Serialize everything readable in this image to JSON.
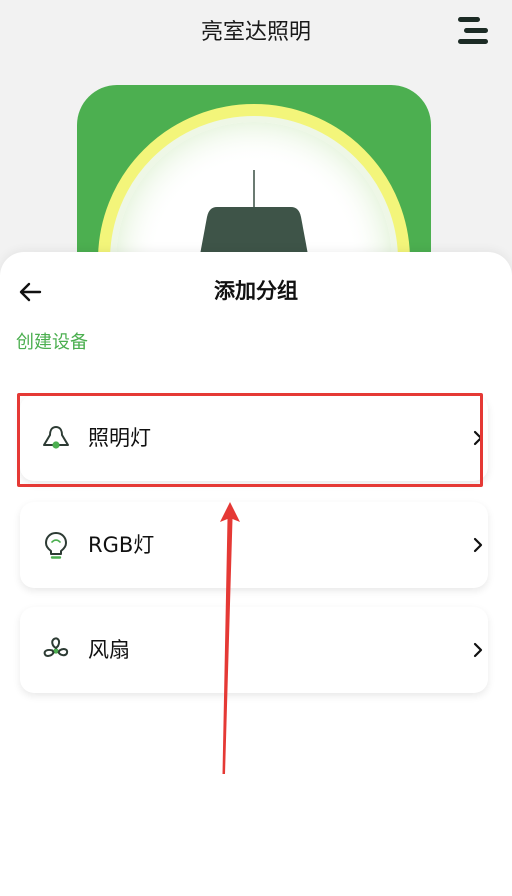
{
  "header": {
    "title": "亮室达照明"
  },
  "sheet": {
    "title": "添加分组",
    "section_label": "创建设备",
    "items": [
      {
        "label": "照明灯",
        "icon": "lamp-icon"
      },
      {
        "label": "RGB灯",
        "icon": "bulb-icon"
      },
      {
        "label": "风扇",
        "icon": "fan-icon"
      }
    ]
  },
  "colors": {
    "brand_green": "#4caf50",
    "highlight_red": "#e53935",
    "ring_yellow": "#f3f57a",
    "lamp_dark": "#3e5448"
  }
}
